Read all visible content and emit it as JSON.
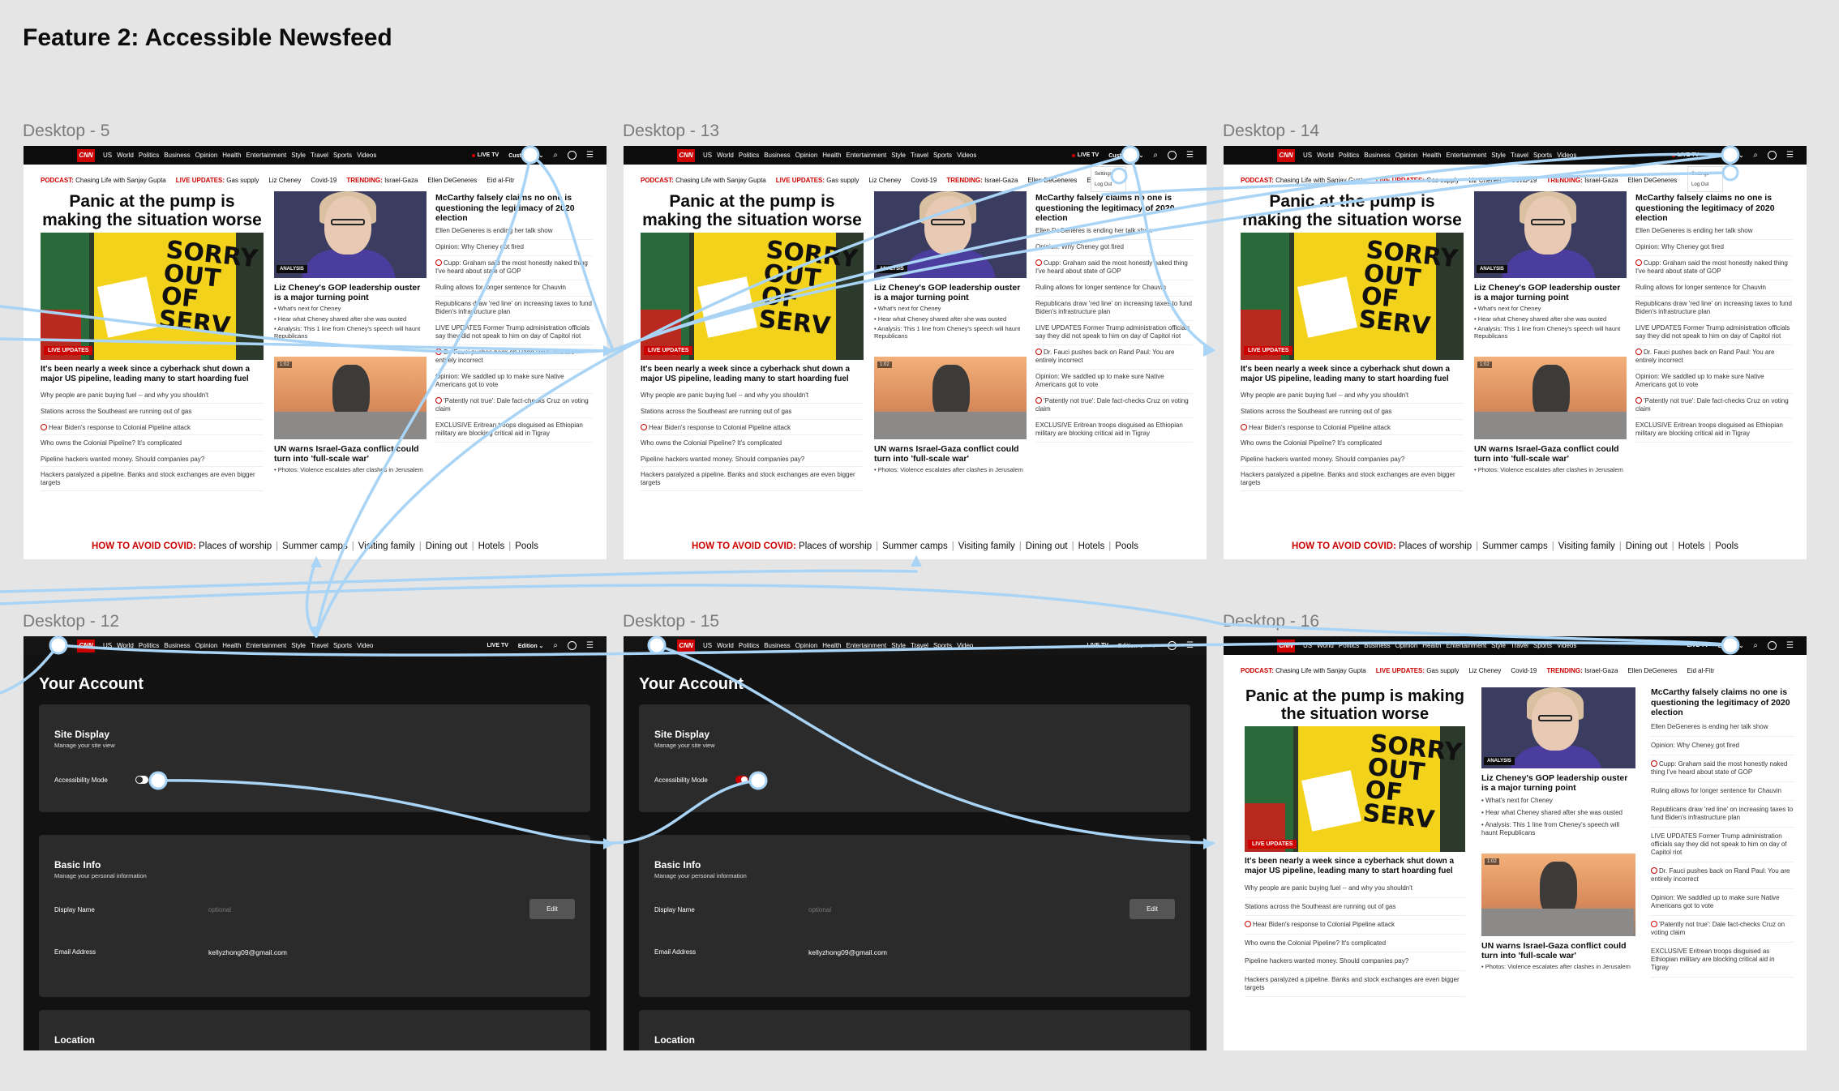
{
  "page_title": "Feature 2: Accessible Newsfeed",
  "frames": [
    {
      "label": "Desktop - 5"
    },
    {
      "label": "Desktop - 13"
    },
    {
      "label": "Desktop - 14"
    },
    {
      "label": "Desktop - 12"
    },
    {
      "label": "Desktop - 15"
    },
    {
      "label": "Desktop - 16"
    }
  ],
  "cnn": {
    "logo": "CNN",
    "nav_items": [
      "US",
      "World",
      "Politics",
      "Business",
      "Opinion",
      "Health",
      "Entertainment",
      "Style",
      "Travel",
      "Sports",
      "Videos"
    ],
    "live_tv": "LIVE TV",
    "customize": "Customize",
    "ticker": [
      {
        "label": "PODCAST:",
        "text": "Chasing Life with Sanjay Gupta"
      },
      {
        "label": "LIVE UPDATES:",
        "text": "Gas supply"
      },
      {
        "label": "",
        "text": "Liz Cheney"
      },
      {
        "label": "",
        "text": "Covid-19"
      },
      {
        "label": "TRENDING:",
        "text": "Israel-Gaza"
      },
      {
        "label": "",
        "text": "Ellen DeGeneres"
      },
      {
        "label": "",
        "text": "Eid al-Fitr"
      }
    ],
    "main_headline": "Panic at the pump is making the situation worse",
    "hero_badge": "LIVE UPDATES",
    "hero_sign": "SORRY OUT OF SERV",
    "lead": "It's been nearly a week since a cyberhack shut down a major US pipeline, leading many to start hoarding fuel",
    "lead_list": [
      "Why people are panic buying fuel -- and why you shouldn't",
      "Stations across the Southeast are running out of gas",
      "Hear Biden's response to Colonial Pipeline attack",
      "Who owns the Colonial Pipeline? It's complicated",
      "Pipeline hackers wanted money. Should companies pay?",
      "Hackers paralyzed a pipeline. Banks and stock exchanges are even bigger targets"
    ],
    "analysis_badge": "ANALYSIS",
    "liz_headline": "Liz Cheney's GOP leadership ouster is a major turning point",
    "liz_bullets": [
      "• What's next for Cheney",
      "• Hear what Cheney shared after she was ousted",
      "• Analysis: This 1 line from Cheney's speech will haunt Republicans"
    ],
    "gaza_time": "1:02",
    "gaza_headline": "UN warns Israel-Gaza conflict could turn into 'full-scale war'",
    "gaza_sub": "• Photos: Violence escalates after clashes in Jerusalem",
    "right_headline": "McCarthy falsely claims no one is questioning the legitimacy of 2020 election",
    "right_list": [
      "Ellen DeGeneres is ending her talk show",
      "Opinion: Why Cheney got fired",
      "Cupp: Graham said the most honestly naked thing I've heard about state of GOP",
      "Ruling allows for longer sentence for Chauvin",
      "Republicans draw 'red line' on increasing taxes to fund Biden's infrastructure plan",
      "LIVE UPDATES Former Trump administration officials say they did not speak to him on day of Capitol riot",
      "Dr. Fauci pushes back on Rand Paul: You are entirely incorrect",
      "Opinion: We saddled up to make sure Native Americans got to vote",
      "'Patently not true': Dale fact-checks Cruz on voting claim",
      "EXCLUSIVE Eritrean troops disguised as Ethiopian military are blocking critical aid in Tigray"
    ],
    "covid_label": "HOW TO AVOID COVID:",
    "covid_items": [
      "Places of worship",
      "Summer camps",
      "Visiting family",
      "Dining out",
      "Hotels",
      "Pools"
    ],
    "dropdown": [
      "Settings",
      "Log Out"
    ]
  },
  "account": {
    "nav_items": [
      "US",
      "World",
      "Politics",
      "Business",
      "Opinion",
      "Health",
      "Entertainment",
      "Style",
      "Travel",
      "Sports",
      "Video"
    ],
    "live_tv": "LIVE TV",
    "edition": "Edition",
    "title": "Your Account",
    "site_display_title": "Site Display",
    "site_display_sub": "Manage your site view",
    "accessibility_label": "Accessibility Mode",
    "basic_info_title": "Basic Info",
    "basic_info_sub": "Manage your personal information",
    "display_name_label": "Display Name",
    "display_name_placeholder": "optional",
    "edit_label": "Edit",
    "email_label": "Email Address",
    "email_value": "kellyzhong09@gmail.com",
    "location_title": "Location",
    "accessibility_off": false,
    "accessibility_on": true
  },
  "colors": {
    "cnn_red": "#cc0000",
    "flow_line": "#a9d4f5",
    "canvas": "#e5e5e5",
    "dark_bg": "#121212"
  }
}
